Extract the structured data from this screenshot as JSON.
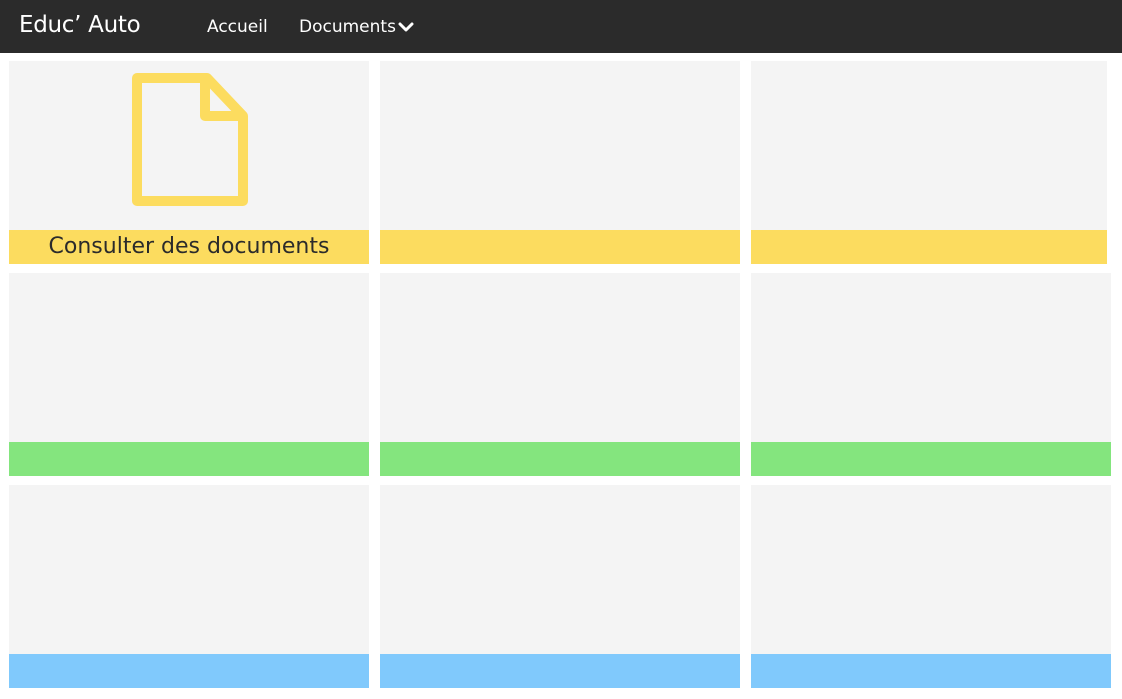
{
  "navbar": {
    "brand": "Educ’ Auto",
    "links": [
      {
        "label": "Accueil"
      },
      {
        "label": "Documents"
      }
    ]
  },
  "tiles": [
    {
      "label": "Consulter des documents",
      "icon": "document-icon",
      "color": "#fcdc5f"
    },
    {
      "label": "",
      "color": "#fcdc5f"
    },
    {
      "label": "",
      "color": "#fcdc5f"
    },
    {
      "label": "",
      "color": "#84e57e"
    },
    {
      "label": "",
      "color": "#84e57e"
    },
    {
      "label": "",
      "color": "#84e57e"
    },
    {
      "label": "",
      "color": "#80c9fc"
    },
    {
      "label": "",
      "color": "#80c9fc"
    },
    {
      "label": "",
      "color": "#80c9fc"
    }
  ],
  "theme": {
    "navbar_bg": "#2b2b2b",
    "tile_bg": "#f4f4f4",
    "icon_color": "#fcdc5f"
  }
}
